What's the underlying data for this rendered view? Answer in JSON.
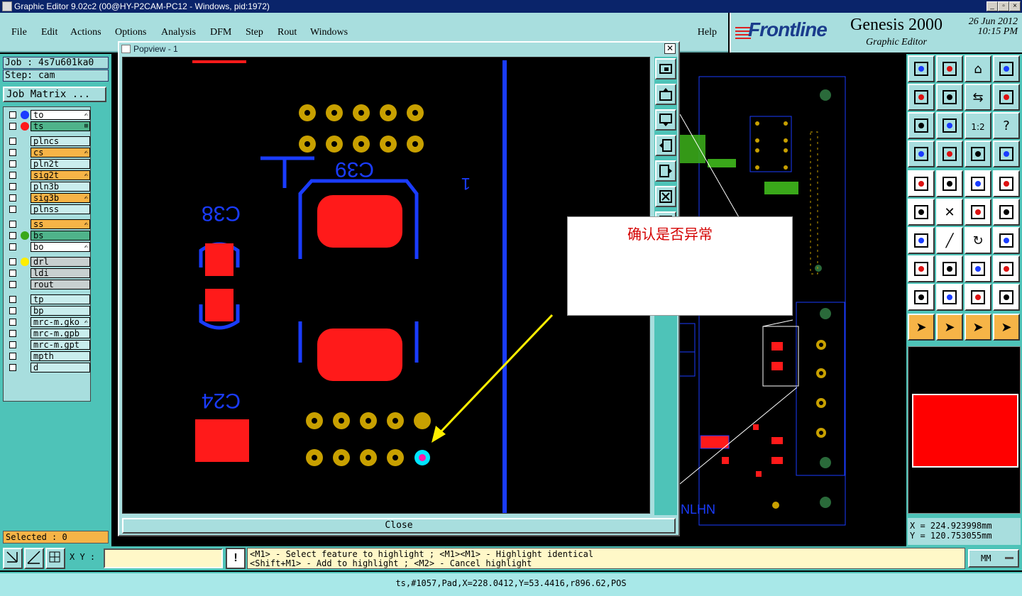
{
  "window": {
    "title": "Graphic Editor 9.02c2 (00@HY-P2CAM-PC12 - Windows, pid:1972)"
  },
  "menu": [
    "File",
    "Edit",
    "Actions",
    "Options",
    "Analysis",
    "DFM",
    "Step",
    "Rout",
    "Windows"
  ],
  "help_label": "Help",
  "brand": {
    "logo": "Frontline",
    "product": "Genesis 2000",
    "subtitle": "Graphic Editor",
    "date": "26 Jun 2012",
    "time": "10:15 PM"
  },
  "job": {
    "label": "Job : 4s7u601ka0",
    "step": "Step: cam",
    "matrix_button": "Job Matrix ..."
  },
  "layers": [
    {
      "name": "to",
      "color": "white",
      "dot": "#1a3cff",
      "mark": "✍"
    },
    {
      "name": "ts",
      "color": "green",
      "dot": "#ff1a1a",
      "mark": "⊞"
    },
    {
      "name": "plncs",
      "color": "",
      "dot": "",
      "mark": ""
    },
    {
      "name": "cs",
      "color": "orange",
      "dot": "",
      "mark": "✍"
    },
    {
      "name": "pln2t",
      "color": "",
      "dot": "",
      "mark": ""
    },
    {
      "name": "sig2t",
      "color": "orange",
      "dot": "",
      "mark": "✍"
    },
    {
      "name": "pln3b",
      "color": "",
      "dot": "",
      "mark": ""
    },
    {
      "name": "sig3b",
      "color": "orange",
      "dot": "",
      "mark": "✍"
    },
    {
      "name": "plnss",
      "color": "",
      "dot": "",
      "mark": ""
    },
    {
      "name": "ss",
      "color": "orange",
      "dot": "",
      "mark": "✍"
    },
    {
      "name": "bs",
      "color": "green",
      "dot": "#3aa81a",
      "mark": ""
    },
    {
      "name": "bo",
      "color": "white",
      "dot": "",
      "mark": "✍"
    },
    {
      "name": "drl",
      "color": "grey",
      "dot": "#ffee00",
      "mark": ""
    },
    {
      "name": "ldi",
      "color": "grey",
      "dot": "",
      "mark": ""
    },
    {
      "name": "rout",
      "color": "grey",
      "dot": "",
      "mark": ""
    },
    {
      "name": "tp",
      "color": "",
      "dot": "",
      "mark": ""
    },
    {
      "name": "bp",
      "color": "",
      "dot": "",
      "mark": ""
    },
    {
      "name": "mrc-m.gko",
      "color": "",
      "dot": "",
      "mark": "✍"
    },
    {
      "name": "mrc-m.gpb",
      "color": "",
      "dot": "",
      "mark": ""
    },
    {
      "name": "mrc-m.gpt",
      "color": "",
      "dot": "",
      "mark": ""
    },
    {
      "name": "mpth",
      "color": "",
      "dot": "",
      "mark": ""
    },
    {
      "name": "d",
      "color": "",
      "dot": "",
      "mark": ""
    }
  ],
  "selected": "Selected : 0",
  "popview": {
    "title": "Popview - 1",
    "close_label": "Close",
    "silk_labels": {
      "c39": "C39",
      "c38": "C38",
      "c24": "C24",
      "one": "1"
    }
  },
  "board": {
    "silk_nlhn": "NLHN"
  },
  "note": {
    "text": "确认是否异常"
  },
  "coords": {
    "x": "X = 224.923998mm",
    "y": "Y = 120.753055mm"
  },
  "bottom": {
    "xy_label": "X Y :",
    "xy_value": "",
    "hint_line1": "<M1> - Select feature to highlight ; <M1><M1> - Highlight identical",
    "hint_line2": "<Shift+M1> - Add to highlight ; <M2> - Cancel highlight",
    "units": "MM"
  },
  "status": "ts,#1057,Pad,X=228.0412,Y=53.4416,r896.62,POS"
}
